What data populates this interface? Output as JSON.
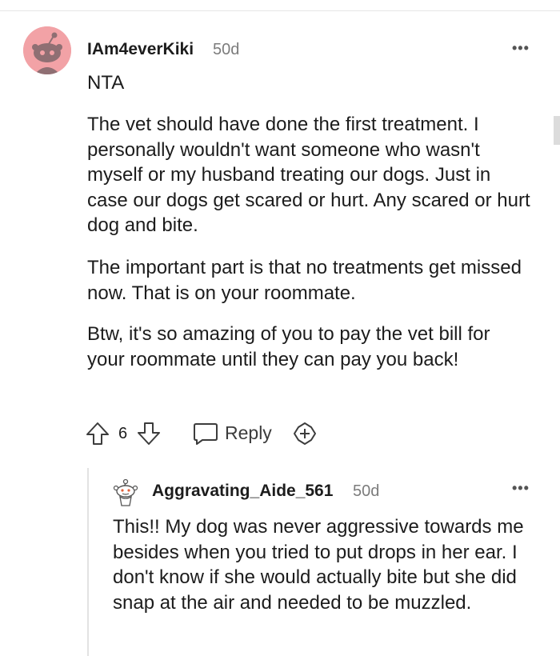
{
  "comment": {
    "username": "IAm4everKiki",
    "age": "50d",
    "paragraphs": [
      "NTA",
      "The vet should have done the first treatment. I personally wouldn't want someone who wasn't myself or my husband treating our dogs. Just in case our dogs get scared or hurt. Any scared or hurt dog and bite.",
      "The important part is that no treatments get missed now. That is on your roommate.",
      "Btw, it's so amazing of you to pay the vet bill for your roommate until they can pay you back!"
    ],
    "vote_count": "6",
    "reply_label": "Reply",
    "avatar_color": "#f2a2a6",
    "icons": [
      "upvote-icon",
      "downvote-icon",
      "comment-icon",
      "award-icon",
      "more-options-icon"
    ]
  },
  "reply": {
    "username": "Aggravating_Aide_561",
    "age": "50d",
    "text": "This!! My dog was never aggressive towards me besides when you tried to put drops in her ear. I don't know if she would actually bite but she did snap at the air and needed to be muzzled."
  }
}
